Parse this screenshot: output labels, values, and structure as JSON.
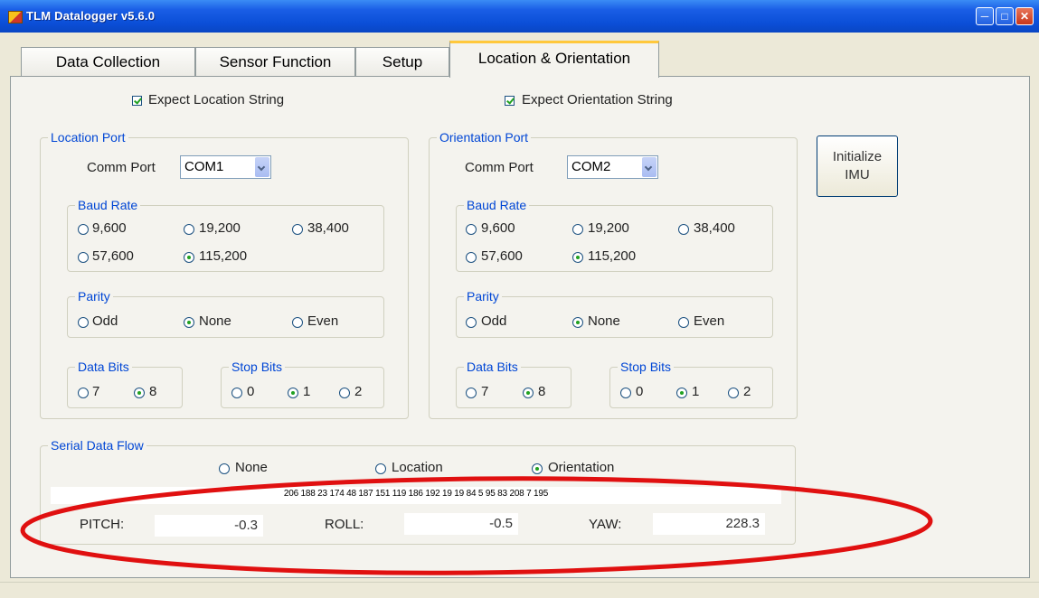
{
  "window": {
    "title": "TLM Datalogger v5.6.0"
  },
  "tabs": [
    {
      "label": "Data Collection"
    },
    {
      "label": "Sensor Function"
    },
    {
      "label": "Setup"
    },
    {
      "label": "Location & Orientation"
    }
  ],
  "active_tab": "Location & Orientation",
  "location": {
    "expect_label": "Expect Location String",
    "expect_checked": true,
    "group_label": "Location Port",
    "comm_port_label": "Comm Port",
    "comm_port_value": "COM1",
    "baud_label": "Baud Rate",
    "baud_options": [
      "9,600",
      "19,200",
      "38,400",
      "57,600",
      "115,200"
    ],
    "baud_selected": "115,200",
    "parity_label": "Parity",
    "parity_options": [
      "Odd",
      "None",
      "Even"
    ],
    "parity_selected": "None",
    "data_bits_label": "Data Bits",
    "data_bits_options": [
      "7",
      "8"
    ],
    "data_bits_selected": "8",
    "stop_bits_label": "Stop Bits",
    "stop_bits_options": [
      "0",
      "1",
      "2"
    ],
    "stop_bits_selected": "1"
  },
  "orientation": {
    "expect_label": "Expect Orientation String",
    "expect_checked": true,
    "group_label": "Orientation Port",
    "comm_port_label": "Comm Port",
    "comm_port_value": "COM2",
    "baud_label": "Baud Rate",
    "baud_options": [
      "9,600",
      "19,200",
      "38,400",
      "57,600",
      "115,200"
    ],
    "baud_selected": "115,200",
    "parity_label": "Parity",
    "parity_options": [
      "Odd",
      "None",
      "Even"
    ],
    "parity_selected": "None",
    "data_bits_label": "Data Bits",
    "data_bits_options": [
      "7",
      "8"
    ],
    "data_bits_selected": "8",
    "stop_bits_label": "Stop Bits",
    "stop_bits_options": [
      "0",
      "1",
      "2"
    ],
    "stop_bits_selected": "1"
  },
  "init_imu_label": "Initialize IMU",
  "serial_flow": {
    "group_label": "Serial Data Flow",
    "options": [
      "None",
      "Location",
      "Orientation"
    ],
    "selected": "Orientation",
    "raw_data": "206 188 23 174 48 187 151 119 186 192 19 19 84 5 95 83 208 7 195"
  },
  "readouts": {
    "pitch_label": "PITCH:",
    "pitch_value": "-0.3",
    "roll_label": "ROLL:",
    "roll_value": "-0.5",
    "yaw_label": "YAW:",
    "yaw_value": "228.3"
  },
  "colors": {
    "annotation_ellipse": "#e01010",
    "group_label": "#0046d5",
    "radio_dot": "#21a121"
  }
}
